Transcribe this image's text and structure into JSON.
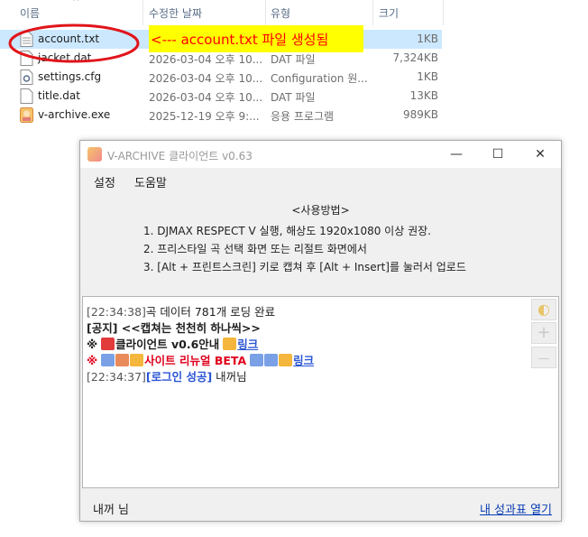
{
  "explorer": {
    "columns": {
      "name": "이름",
      "date": "수정한 날짜",
      "type": "유형",
      "size": "크기"
    },
    "files": [
      {
        "name": "account.txt",
        "date": "",
        "type": "",
        "size": "1KB",
        "icon": "text-file-icon"
      },
      {
        "name": "jacket.dat",
        "date": "2026-03-04 오후 10...",
        "type": "DAT 파일",
        "size": "7,324KB",
        "icon": "blank-file-icon"
      },
      {
        "name": "settings.cfg",
        "date": "2026-03-04 오후 10...",
        "type": "Configuration 원...",
        "size": "1KB",
        "icon": "config-file-icon"
      },
      {
        "name": "title.dat",
        "date": "2026-03-04 오후 10...",
        "type": "DAT 파일",
        "size": "13KB",
        "icon": "blank-file-icon"
      },
      {
        "name": "v-archive.exe",
        "date": "2025-12-19 오후 9:...",
        "type": "응용 프로그램",
        "size": "989KB",
        "icon": "app-icon"
      }
    ],
    "annotation": "<--- account.txt 파일 생성됨",
    "colors": {
      "annotation_bg": "#ffff00",
      "annotation_text": "#ff0000",
      "highlight_ellipse": "#e0151b",
      "selected_row": "#cce8ff"
    }
  },
  "window": {
    "title": "V-ARCHIVE 클라이언트 v0.63",
    "controls": {
      "minimize": "—",
      "maximize": "☐",
      "close": "✕"
    },
    "menu": {
      "settings": "설정",
      "help": "도움말"
    },
    "instructions": {
      "title": "<사용방법>",
      "lines": [
        "1. DJMAX RESPECT V 실행,  해상도 1920x1080 이상 권장.",
        "2. 프리스타일 곡 선택 화면 또는 리절트 화면에서",
        "3. [Alt + 프린트스크린] 키로 캡쳐 후 [Alt + Insert]를 눌러서 업로드"
      ]
    },
    "log": {
      "line1": {
        "ts": "[22:34:38]",
        "text": "곡 데이터 781개 로딩 완료"
      },
      "line2": {
        "text": "[공지] <<캡쳐는 천천히 하나씩>>"
      },
      "line3": {
        "prefix": "※",
        "text": "클라이언트 v0.6안내",
        "link": "링크"
      },
      "line4": {
        "prefix": "※",
        "text": "사이트 리뉴얼 BETA",
        "link": "링크"
      },
      "line5": {
        "ts": "[22:34:37]",
        "status": "[로그인 성공]",
        "text": " 내꺼님"
      }
    },
    "side_buttons": {
      "theme": "◐",
      "zoom_in": "+",
      "zoom_out": "—"
    },
    "status": {
      "user": "내꺼 님",
      "link": "내 성과표 열기"
    }
  }
}
